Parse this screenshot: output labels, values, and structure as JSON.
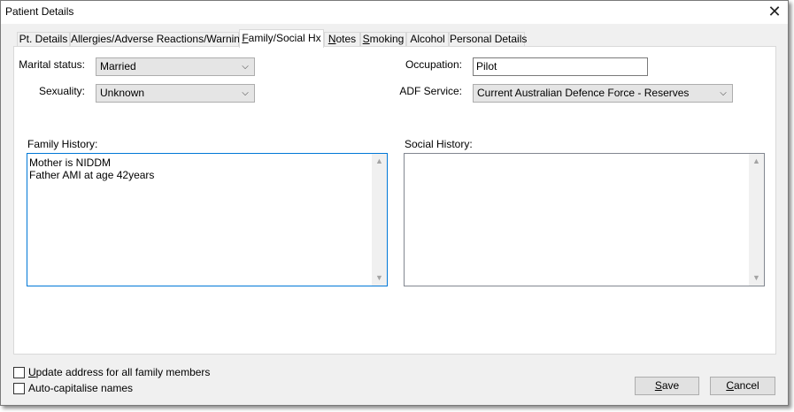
{
  "window": {
    "title": "Patient Details",
    "close_glyph": "✕"
  },
  "tabs": [
    {
      "label": "Pt. Details",
      "mnemonic": ""
    },
    {
      "label": "Allergies/Adverse Reactions/Warnings",
      "mnemonic": ""
    },
    {
      "label": "Family/Social Hx",
      "mnemonic": "F",
      "active": true
    },
    {
      "label": "Notes",
      "mnemonic": "N"
    },
    {
      "label": "Smoking",
      "mnemonic": "S"
    },
    {
      "label": "Alcohol",
      "mnemonic": ""
    },
    {
      "label": "Personal Details",
      "mnemonic": ""
    }
  ],
  "form": {
    "marital_status": {
      "label": "Marital status:",
      "value": "Married"
    },
    "sexuality": {
      "label": "Sexuality:",
      "value": "Unknown"
    },
    "occupation": {
      "label": "Occupation:",
      "value": "Pilot"
    },
    "adf_service": {
      "label": "ADF Service:",
      "value": "Current Australian Defence Force - Reserves"
    },
    "family_history": {
      "label": "Family History:",
      "value": "Mother is NIDDM\nFather AMI at age 42years"
    },
    "social_history": {
      "label": "Social History:",
      "value": ""
    }
  },
  "footer": {
    "update_address": {
      "label_first": "U",
      "label_rest": "pdate address for all family members",
      "checked": false
    },
    "auto_capitalise": {
      "label": "Auto-capitalise names",
      "checked": false
    },
    "save": {
      "first": "S",
      "rest": "ave"
    },
    "cancel": {
      "first": "C",
      "rest": "ancel"
    }
  }
}
